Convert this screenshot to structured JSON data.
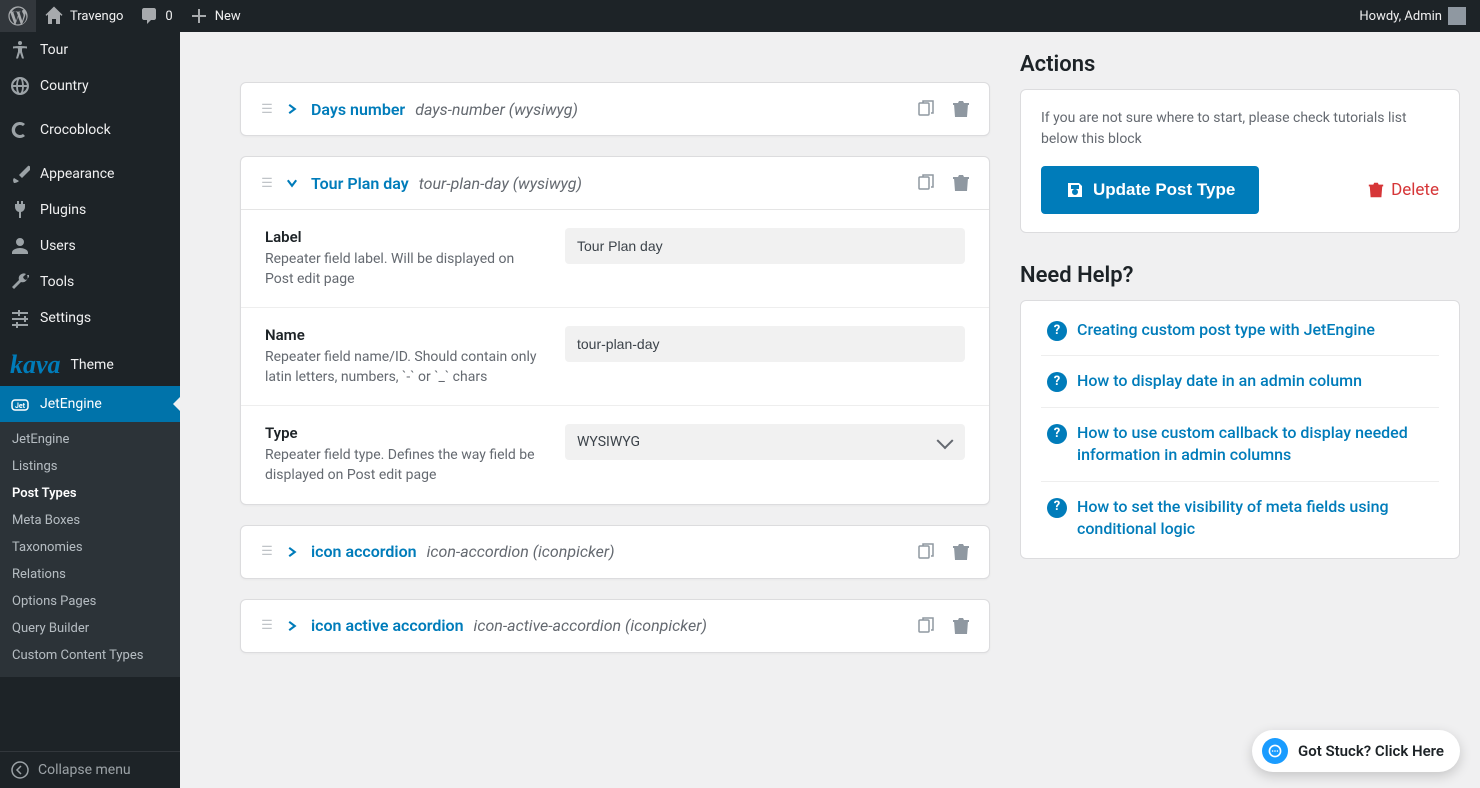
{
  "adminbar": {
    "site_name": "Travengo",
    "comment_count": "0",
    "new_label": "New",
    "howdy": "Howdy, Admin"
  },
  "sidebar": {
    "items": [
      {
        "id": "tour",
        "label": "Tour"
      },
      {
        "id": "country",
        "label": "Country"
      },
      {
        "id": "crocoblock",
        "label": "Crocoblock"
      },
      {
        "id": "appearance",
        "label": "Appearance"
      },
      {
        "id": "plugins",
        "label": "Plugins"
      },
      {
        "id": "users",
        "label": "Users"
      },
      {
        "id": "tools",
        "label": "Tools"
      },
      {
        "id": "settings",
        "label": "Settings"
      },
      {
        "id": "theme",
        "label": "Theme"
      },
      {
        "id": "jetengine",
        "label": "JetEngine"
      }
    ],
    "submenu": [
      {
        "label": "JetEngine"
      },
      {
        "label": "Listings"
      },
      {
        "label": "Post Types"
      },
      {
        "label": "Meta Boxes"
      },
      {
        "label": "Taxonomies"
      },
      {
        "label": "Relations"
      },
      {
        "label": "Options Pages"
      },
      {
        "label": "Query Builder"
      },
      {
        "label": "Custom Content Types"
      }
    ],
    "collapse_label": "Collapse menu"
  },
  "fields": [
    {
      "title": "Days number",
      "slug": "days-number (wysiwyg)",
      "expanded": false
    },
    {
      "title": "Tour Plan day",
      "slug": "tour-plan-day (wysiwyg)",
      "expanded": true,
      "rows": {
        "label": {
          "label": "Label",
          "desc": "Repeater field label. Will be displayed on Post edit page",
          "value": "Tour Plan day"
        },
        "name": {
          "label": "Name",
          "desc": "Repeater field name/ID. Should contain only latin letters, numbers, `-` or `_` chars",
          "value": "tour-plan-day"
        },
        "type": {
          "label": "Type",
          "desc": "Repeater field type. Defines the way field be displayed on Post edit page",
          "value": "WYSIWYG"
        }
      }
    },
    {
      "title": "icon accordion",
      "slug": "icon-accordion (iconpicker)",
      "expanded": false
    },
    {
      "title": "icon active accordion",
      "slug": "icon-active-accordion (iconpicker)",
      "expanded": false
    }
  ],
  "actions": {
    "title": "Actions",
    "note": "If you are not sure where to start, please check tutorials list below this block",
    "update_label": "Update Post Type",
    "delete_label": "Delete"
  },
  "help": {
    "title": "Need Help?",
    "links": [
      "Creating custom post type with JetEngine",
      "How to display date in an admin column",
      "How to use custom callback to display needed information in admin columns",
      "How to set the visibility of meta fields using conditional logic"
    ]
  },
  "help_bubble": "Got Stuck? Click Here"
}
